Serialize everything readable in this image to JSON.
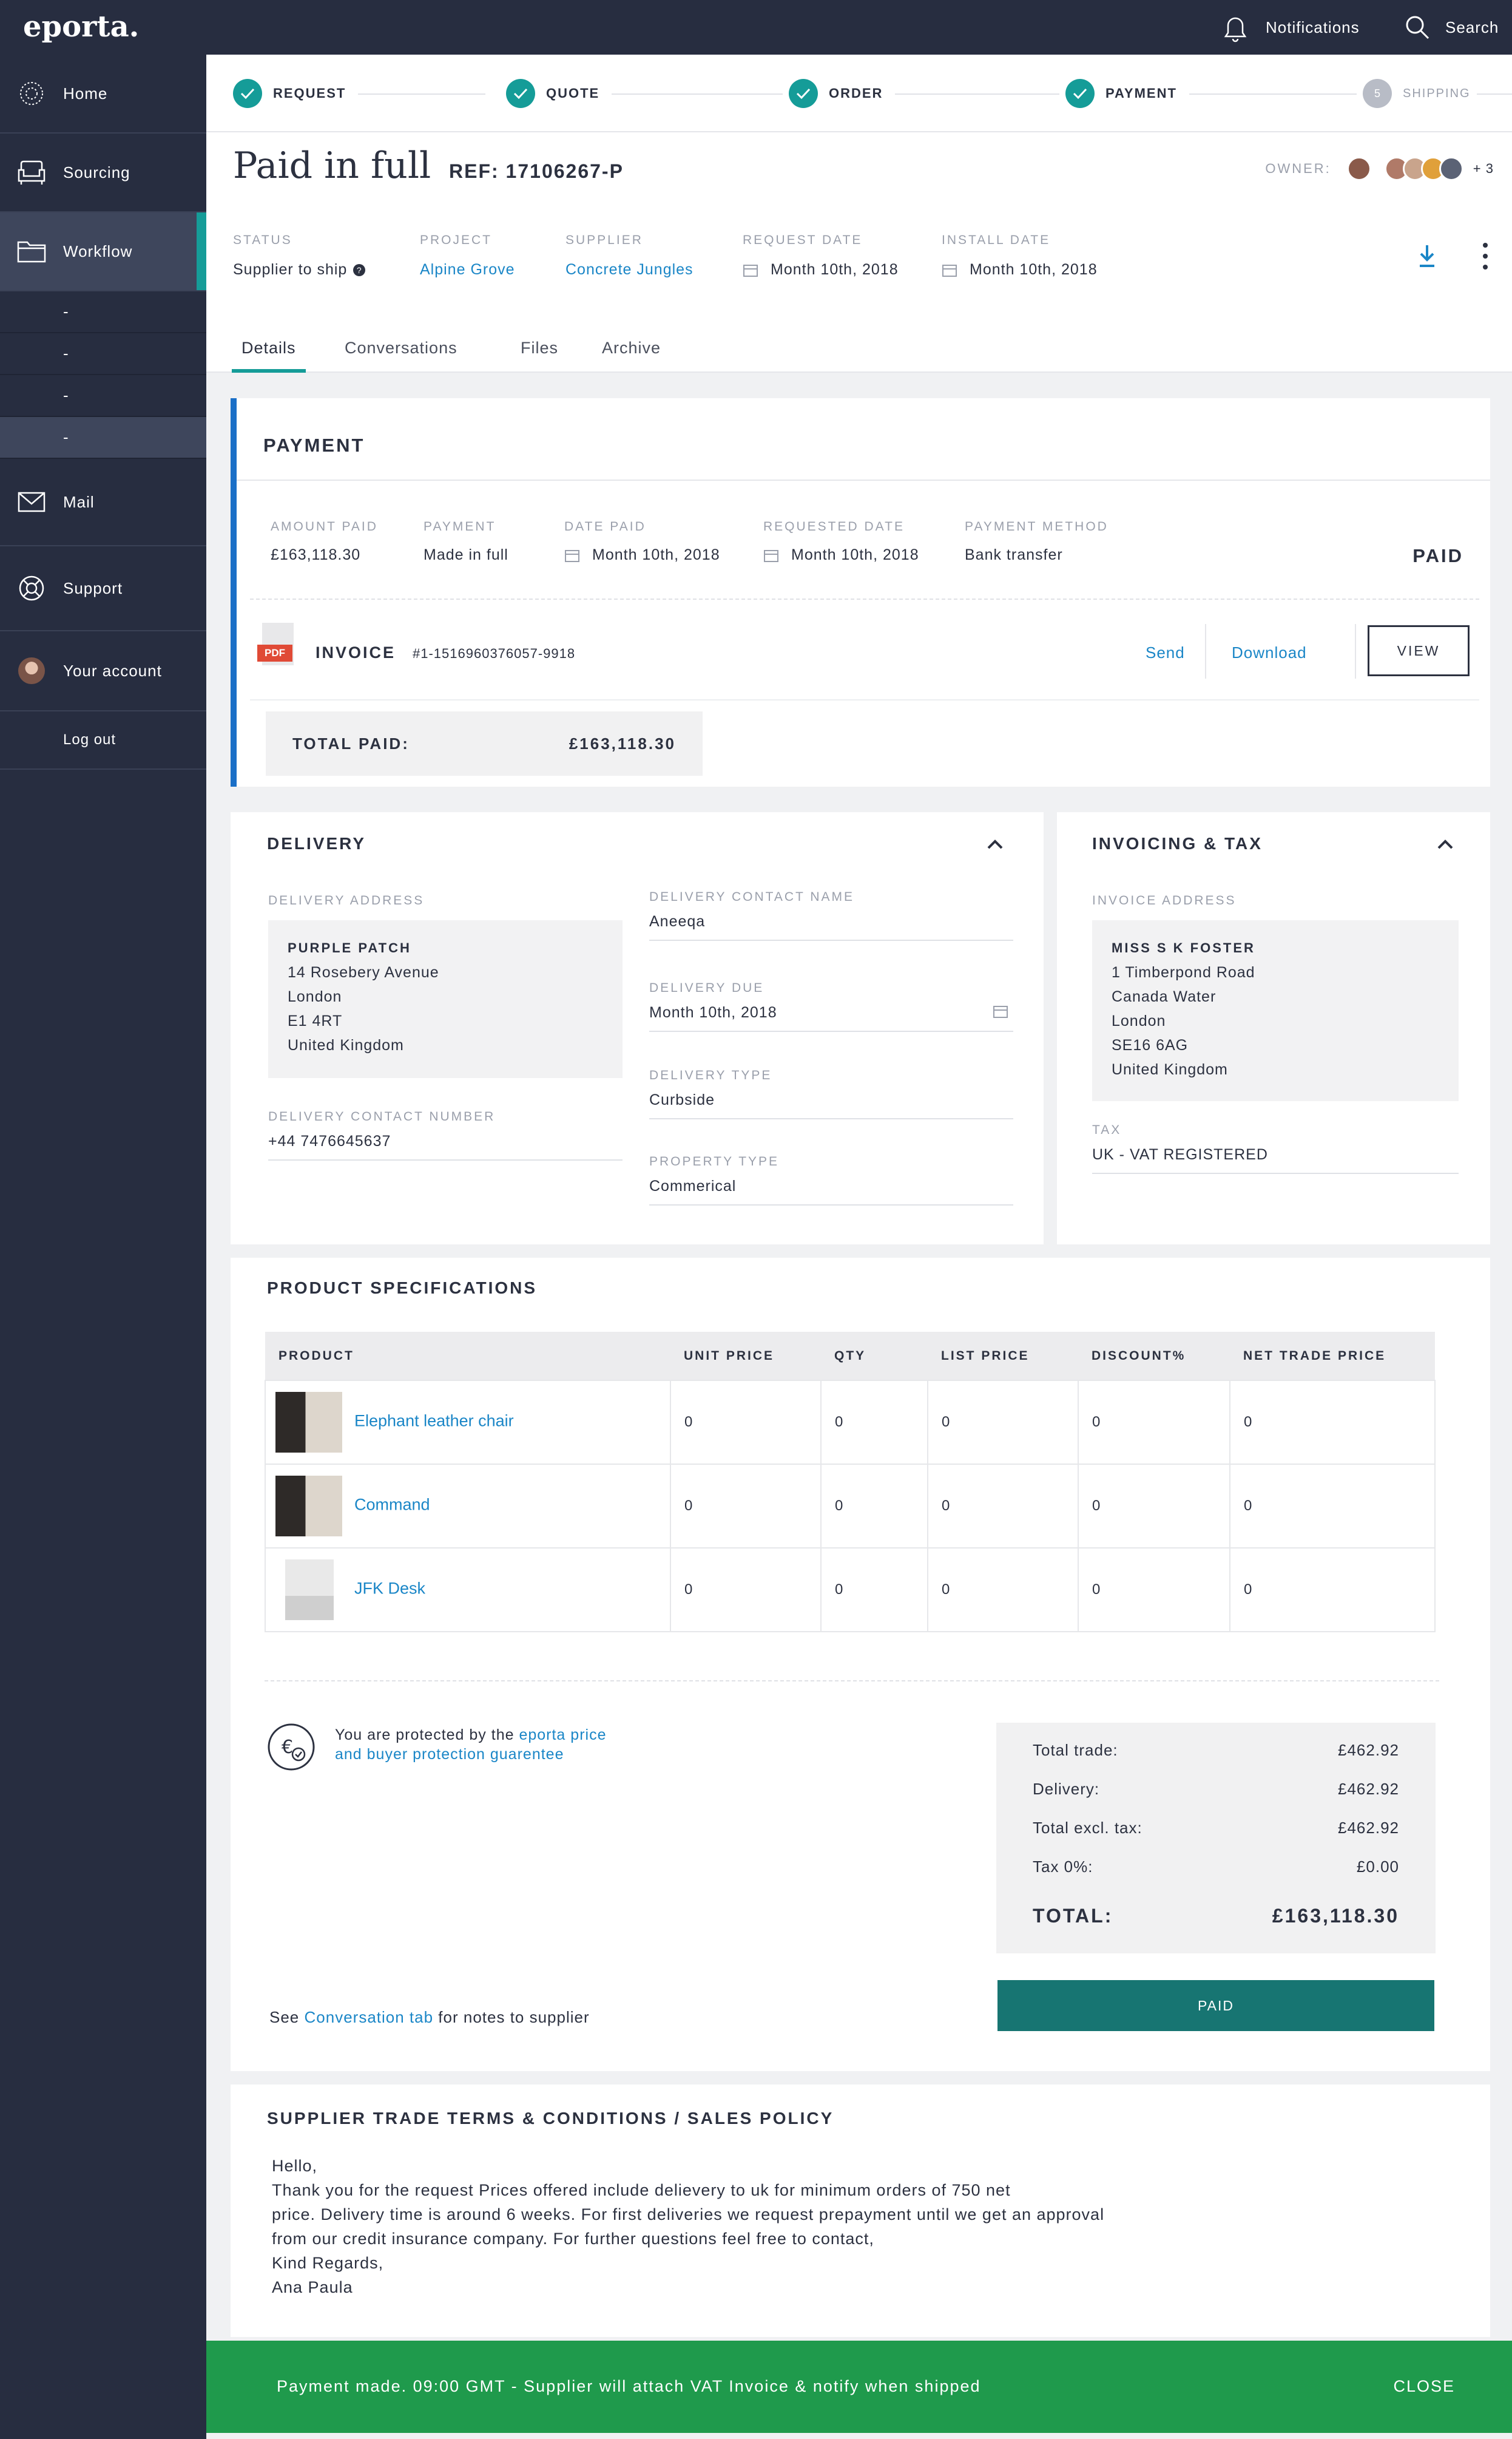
{
  "app": {
    "logo": "eporta.",
    "notifications": "Notifications",
    "search": "Search"
  },
  "sidebar": {
    "home": "Home",
    "sourcing": "Sourcing",
    "workflow": "Workflow",
    "sub_items": [
      "-",
      "-",
      "-",
      "-"
    ],
    "mail": "Mail",
    "support": "Support",
    "account": "Your account",
    "logout": "Log out"
  },
  "steps": [
    {
      "label": "REQUEST"
    },
    {
      "label": "QUOTE"
    },
    {
      "label": "ORDER"
    },
    {
      "label": "PAYMENT"
    },
    {
      "label": "SHIPPING",
      "number": "5"
    }
  ],
  "header": {
    "title": "Paid in full",
    "ref": "REF: 17106267-P",
    "owner_label": "OWNER:",
    "owner_more": "+ 3",
    "status_label": "STATUS",
    "status": "Supplier to ship",
    "project_label": "PROJECT",
    "project": "Alpine Grove",
    "supplier_label": "SUPPLIER",
    "supplier": "Concrete Jungles",
    "request_date_label": "REQUEST DATE",
    "request_date": "Month 10th, 2018",
    "install_date_label": "INSTALL DATE",
    "install_date": "Month 10th, 2018"
  },
  "tabs": [
    "Details",
    "Conversations",
    "Files",
    "Archive"
  ],
  "payment": {
    "title": "PAYMENT",
    "amount_paid_label": "AMOUNT PAID",
    "amount_paid": "£163,118.30",
    "payment_label": "PAYMENT",
    "payment": "Made in full",
    "date_paid_label": "DATE PAID",
    "date_paid": "Month 10th, 2018",
    "requested_date_label": "REQUESTED DATE",
    "requested_date": "Month 10th, 2018",
    "method_label": "PAYMENT METHOD",
    "method": "Bank transfer",
    "status": "PAID",
    "pdf": "PDF",
    "invoice_label": "INVOICE",
    "invoice_no": "#1-1516960376057-9918",
    "send": "Send",
    "download": "Download",
    "view": "VIEW",
    "total_paid_label": "TOTAL PAID:",
    "total_paid": "£163,118.30"
  },
  "delivery": {
    "title": "DELIVERY",
    "address_label": "DELIVERY ADDRESS",
    "address": [
      "PURPLE PATCH",
      "14 Rosebery Avenue",
      "London",
      "E1 4RT",
      "United Kingdom"
    ],
    "contact_number_label": "DELIVERY CONTACT NUMBER",
    "contact_number": "+44 7476645637",
    "contact_name_label": "DELIVERY CONTACT NAME",
    "contact_name": "Aneeqa",
    "due_label": "DELIVERY DUE",
    "due": "Month 10th, 2018",
    "type_label": "DELIVERY TYPE",
    "type": "Curbside",
    "property_label": "PROPERTY TYPE",
    "property": "Commerical"
  },
  "invoicing": {
    "title": "INVOICING & TAX",
    "address_label": "INVOICE ADDRESS",
    "address": [
      "MISS S K FOSTER",
      "1 Timberpond Road",
      "Canada Water",
      "London",
      "SE16 6AG",
      "United Kingdom"
    ],
    "tax_label": "TAX",
    "tax": "UK - VAT REGISTERED"
  },
  "products": {
    "title": "PRODUCT SPECIFICATIONS",
    "columns": [
      "PRODUCT",
      "UNIT PRICE",
      "QTY",
      "LIST PRICE",
      "DISCOUNT%",
      "NET TRADE PRICE"
    ],
    "rows": [
      [
        "Elephant leather chair",
        "0",
        "0",
        "0",
        "0",
        "0"
      ],
      [
        "Command",
        "0",
        "0",
        "0",
        "0",
        "0"
      ],
      [
        "JFK Desk",
        "0",
        "0",
        "0",
        "0",
        "0"
      ]
    ],
    "protect_text": "You are protected by the",
    "protect_link1": "eporta price",
    "protect_link2": "and buyer protection guarentee",
    "see": "See",
    "conv_link": "Conversation tab",
    "notes": "for notes to supplier",
    "totals": [
      {
        "label": "Total trade:",
        "value": "£462.92"
      },
      {
        "label": "Delivery:",
        "value": "£462.92"
      },
      {
        "label": "Total excl. tax:",
        "value": "£462.92"
      },
      {
        "label": "Tax 0%:",
        "value": "£0.00"
      }
    ],
    "total_label": "TOTAL:",
    "total": "£163,118.30",
    "paid_button": "PAID"
  },
  "terms": {
    "title": "SUPPLIER TRADE TERMS & CONDITIONS / SALES POLICY",
    "lines": [
      "Hello,",
      "Thank you for the request Prices offered include delievery to uk for minimum orders of 750 net",
      "price. Delivery time is around 6 weeks. For first deliveries we request prepayment until we get an approval",
      "from our credit insurance company. For further questions feel free to contact,",
      "Kind Regards,",
      "Ana Paula"
    ]
  },
  "banner": {
    "message": "Payment made. 09:00 GMT - Supplier will attach VAT Invoice & notify when shipped",
    "close": "CLOSE"
  }
}
